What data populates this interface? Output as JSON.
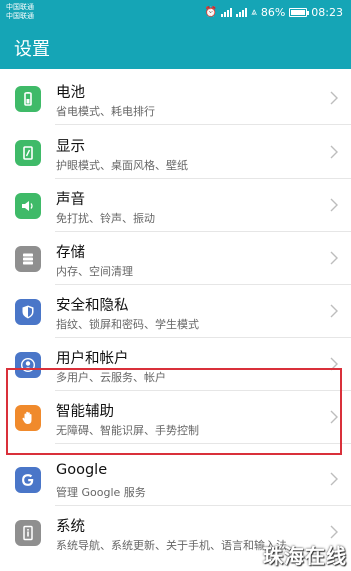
{
  "status_bar": {
    "carrier_1": "中国联通",
    "carrier_2": "中国联通",
    "battery": "86%",
    "battery_level": 0.86,
    "time": "08:23"
  },
  "header": {
    "title": "设置"
  },
  "settings": [
    {
      "title": "电池",
      "subtitle": "省电模式、耗电排行",
      "icon": "battery-icon",
      "color": "#3fba68"
    },
    {
      "title": "显示",
      "subtitle": "护眼模式、桌面风格、壁纸",
      "icon": "display-icon",
      "color": "#3fba68"
    },
    {
      "title": "声音",
      "subtitle": "免打扰、铃声、振动",
      "icon": "speaker-icon",
      "color": "#3fba68"
    },
    {
      "title": "存储",
      "subtitle": "内存、空间清理",
      "icon": "storage-icon",
      "color": "#8f8f8f"
    },
    {
      "title": "安全和隐私",
      "subtitle": "指纹、锁屏和密码、学生模式",
      "icon": "shield-icon",
      "color": "#4a76c8"
    },
    {
      "title": "用户和帐户",
      "subtitle": "多用户、云服务、帐户",
      "icon": "user-icon",
      "color": "#4a76c8"
    },
    {
      "title": "智能辅助",
      "subtitle": "无障碍、智能识屏、手势控制",
      "icon": "hand-icon",
      "color": "#f08a2c"
    },
    {
      "title": "Google",
      "subtitle": "管理 Google 服务",
      "icon": "google-icon",
      "color": "#4a76c8"
    },
    {
      "title": "系统",
      "subtitle": "系统导航、系统更新、关于手机、语言和输入法",
      "icon": "info-icon",
      "color": "#8f8f8f"
    }
  ],
  "watermark": "珠海在线"
}
